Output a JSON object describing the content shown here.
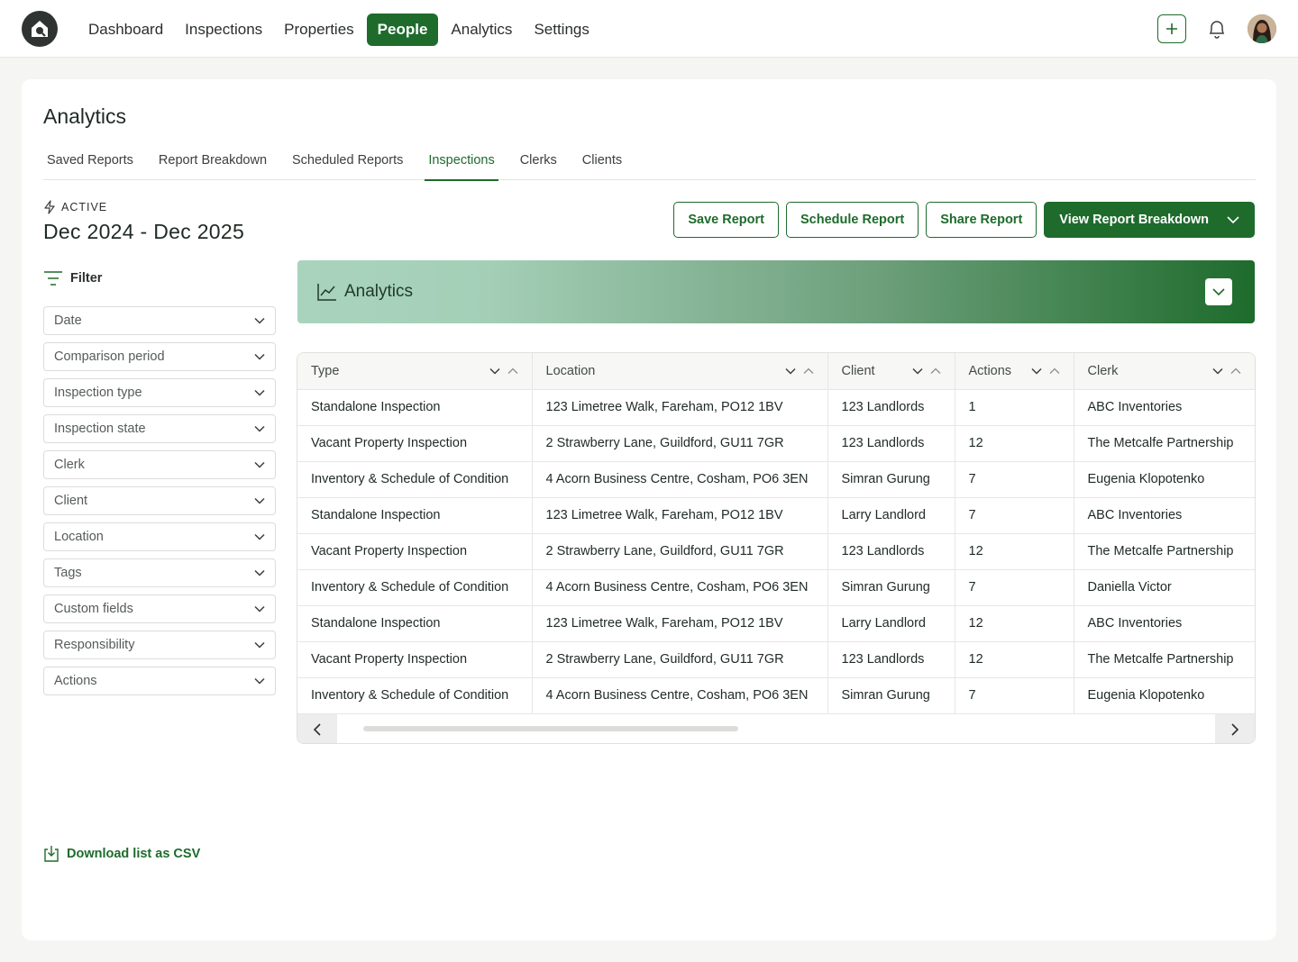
{
  "nav": {
    "items": [
      {
        "label": "Dashboard",
        "active": false
      },
      {
        "label": "Inspections",
        "active": false
      },
      {
        "label": "Properties",
        "active": false
      },
      {
        "label": "People",
        "active": true
      },
      {
        "label": "Analytics",
        "active": false
      },
      {
        "label": "Settings",
        "active": false
      }
    ]
  },
  "page": {
    "title": "Analytics",
    "tabs": [
      {
        "label": "Saved Reports",
        "active": false
      },
      {
        "label": "Report Breakdown",
        "active": false
      },
      {
        "label": "Scheduled Reports",
        "active": false
      },
      {
        "label": "Inspections",
        "active": true
      },
      {
        "label": "Clerks",
        "active": false
      },
      {
        "label": "Clients",
        "active": false
      }
    ],
    "status": "ACTIVE",
    "date_range": "Dec 2024 - Dec 2025"
  },
  "actions": {
    "save": "Save Report",
    "schedule": "Schedule Report",
    "share": "Share Report",
    "view_breakdown": "View Report Breakdown"
  },
  "filter": {
    "title": "Filter",
    "items": [
      "Date",
      "Comparison period",
      "Inspection type",
      "Inspection state",
      "Clerk",
      "Client",
      "Location",
      "Tags",
      "Custom fields",
      "Responsibility",
      "Actions"
    ]
  },
  "banner": {
    "title": "Analytics"
  },
  "table": {
    "columns": [
      "Type",
      "Location",
      "Client",
      "Actions",
      "Clerk"
    ],
    "rows": [
      [
        "Standalone Inspection",
        "123 Limetree Walk, Fareham, PO12 1BV",
        "123 Landlords",
        "1",
        "ABC Inventories"
      ],
      [
        "Vacant Property Inspection",
        "2 Strawberry Lane, Guildford, GU11 7GR",
        "123 Landlords",
        "12",
        "The Metcalfe Partnership"
      ],
      [
        "Inventory & Schedule of Condition",
        "4 Acorn Business Centre, Cosham, PO6 3EN",
        "Simran Gurung",
        "7",
        "Eugenia Klopotenko"
      ],
      [
        "Standalone Inspection",
        "123 Limetree Walk, Fareham, PO12 1BV",
        "Larry Landlord",
        "7",
        "ABC Inventories"
      ],
      [
        "Vacant Property Inspection",
        "2 Strawberry Lane, Guildford, GU11 7GR",
        "123 Landlords",
        "12",
        "The Metcalfe Partnership"
      ],
      [
        "Inventory & Schedule of Condition",
        "4 Acorn Business Centre, Cosham, PO6 3EN",
        "Simran Gurung",
        "7",
        "Daniella Victor"
      ],
      [
        "Standalone Inspection",
        "123 Limetree Walk, Fareham, PO12 1BV",
        "Larry Landlord",
        "12",
        "ABC Inventories"
      ],
      [
        "Vacant Property Inspection",
        "2 Strawberry Lane, Guildford, GU11 7GR",
        "123 Landlords",
        "12",
        "The Metcalfe Partnership"
      ],
      [
        "Inventory & Schedule of Condition",
        "4 Acorn Business Centre, Cosham, PO6 3EN",
        "Simran Gurung",
        "7",
        "Eugenia Klopotenko"
      ]
    ]
  },
  "download": {
    "label": "Download list as CSV"
  },
  "colors": {
    "brand": "#1e6b2c",
    "banner_light": "#a9d3bd"
  },
  "icons": [
    "home-logo-icon",
    "plus-icon",
    "bell-icon",
    "avatar",
    "lightning-icon",
    "filter-icon",
    "chevron-down-icon",
    "chart-line-icon",
    "sort-up-icon",
    "sort-down-icon",
    "chevron-left-icon",
    "chevron-right-icon",
    "download-icon"
  ]
}
